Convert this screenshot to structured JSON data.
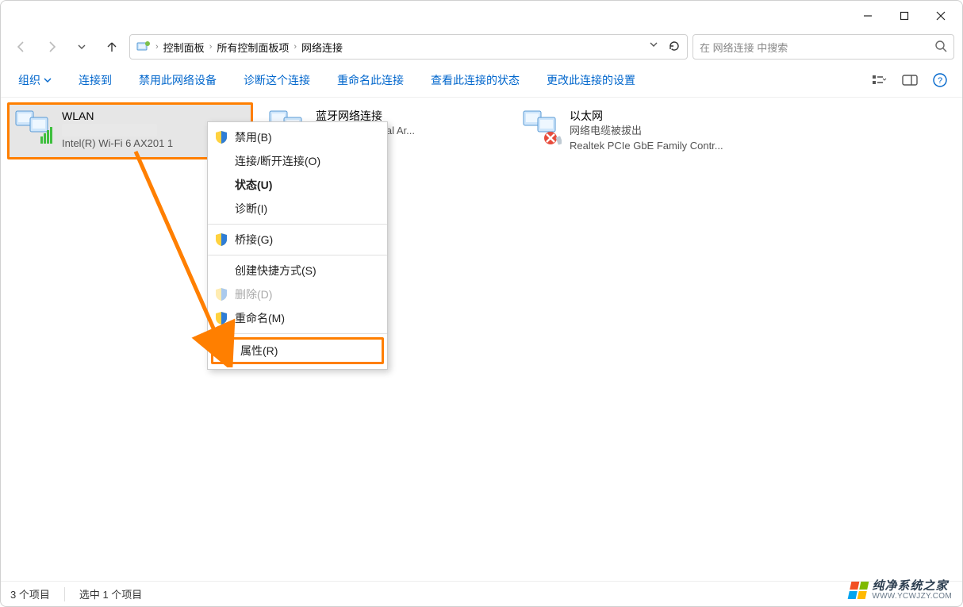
{
  "breadcrumb": {
    "items": [
      "控制面板",
      "所有控制面板项",
      "网络连接"
    ]
  },
  "search": {
    "placeholder": "在 网络连接 中搜索"
  },
  "toolbar": {
    "organize": "组织",
    "items": [
      "连接到",
      "禁用此网络设备",
      "诊断这个连接",
      "重命名此连接",
      "查看此连接的状态",
      "更改此连接的设置"
    ]
  },
  "adapters": [
    {
      "title": "WLAN",
      "line2_blurred": true,
      "line3": "Intel(R) Wi-Fi 6 AX201 1",
      "selected": true,
      "highlighted": true,
      "type": "wifi"
    },
    {
      "title": "蓝牙网络连接",
      "line2": "",
      "line3": "Device (Personal Ar...",
      "type": "bt"
    },
    {
      "title": "以太网",
      "line2": "网络电缆被拔出",
      "line3": "Realtek PCIe GbE Family Contr...",
      "type": "eth_disconnected"
    }
  ],
  "context_menu": {
    "items": [
      {
        "label": "禁用(B)",
        "shield": true
      },
      {
        "label": "连接/断开连接(O)"
      },
      {
        "label": "状态(U)",
        "bold": true
      },
      {
        "label": "诊断(I)"
      },
      {
        "divider": true
      },
      {
        "label": "桥接(G)",
        "shield": true
      },
      {
        "divider": true
      },
      {
        "label": "创建快捷方式(S)"
      },
      {
        "label": "删除(D)",
        "shield": true,
        "disabled": true
      },
      {
        "label": "重命名(M)",
        "shield": true
      },
      {
        "divider": true
      },
      {
        "label": "属性(R)",
        "shield": true,
        "highlighted": true
      }
    ]
  },
  "statusbar": {
    "items_count": "3 个项目",
    "selection": "选中 1 个项目"
  },
  "watermark": {
    "title": "纯净系统之家",
    "url": "WWW.YCWJZY.COM"
  }
}
